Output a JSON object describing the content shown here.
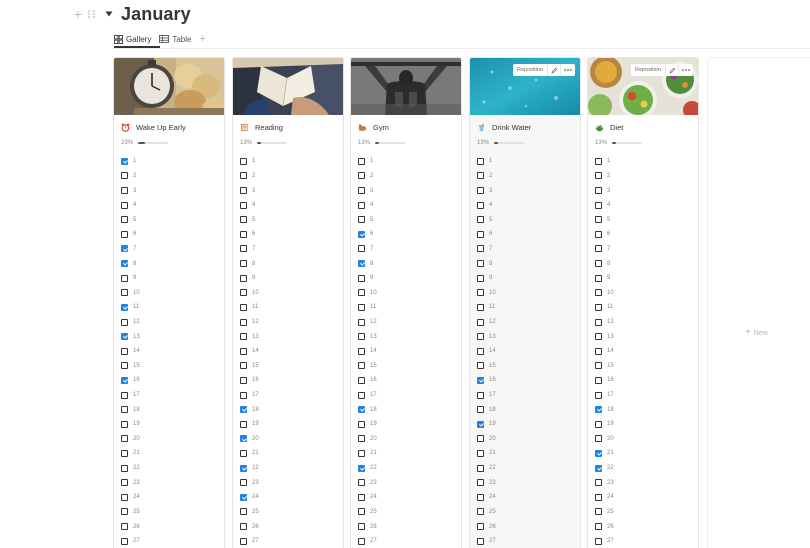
{
  "page": {
    "title": "January"
  },
  "tabs": [
    {
      "label": "Gallery",
      "active": true
    },
    {
      "label": "Table",
      "active": false
    }
  ],
  "columns": [
    {
      "name": "Wake Up Early",
      "emoji": "alarm-clock-icon",
      "progress": "23%",
      "progress_value": 0.23,
      "checked": [
        1,
        7,
        8,
        11,
        13,
        16
      ],
      "hover": false
    },
    {
      "name": "Reading",
      "emoji": "book-icon",
      "progress": "13%",
      "progress_value": 0.13,
      "checked": [
        18,
        20,
        22,
        24
      ],
      "hover": false
    },
    {
      "name": "Gym",
      "emoji": "flexed-biceps-icon",
      "progress": "13%",
      "progress_value": 0.13,
      "checked": [
        6,
        8,
        18,
        22
      ],
      "hover": false
    },
    {
      "name": "Drink Water",
      "emoji": "cup-with-straw-icon",
      "progress": "13%",
      "progress_value": 0.13,
      "checked": [
        16,
        19
      ],
      "hover": true
    },
    {
      "name": "Diet",
      "emoji": "salad-icon",
      "progress": "13%",
      "progress_value": 0.13,
      "checked": [
        18,
        21,
        22
      ],
      "hover": false
    }
  ],
  "items": [
    "1",
    "2",
    "3",
    "4",
    "5",
    "6",
    "7",
    "8",
    "9",
    "10",
    "11",
    "12",
    "13",
    "14",
    "15",
    "16",
    "17",
    "18",
    "19",
    "20",
    "21",
    "22",
    "23",
    "24",
    "25",
    "26",
    "27"
  ],
  "cover_tools": {
    "reposition_label": "Reposition",
    "edit_icon": "pencil-icon",
    "more_icon": "more-icon"
  },
  "new_label": "New",
  "colors": {
    "checkbox_blue": "#2383e2",
    "text": "#37352f"
  }
}
